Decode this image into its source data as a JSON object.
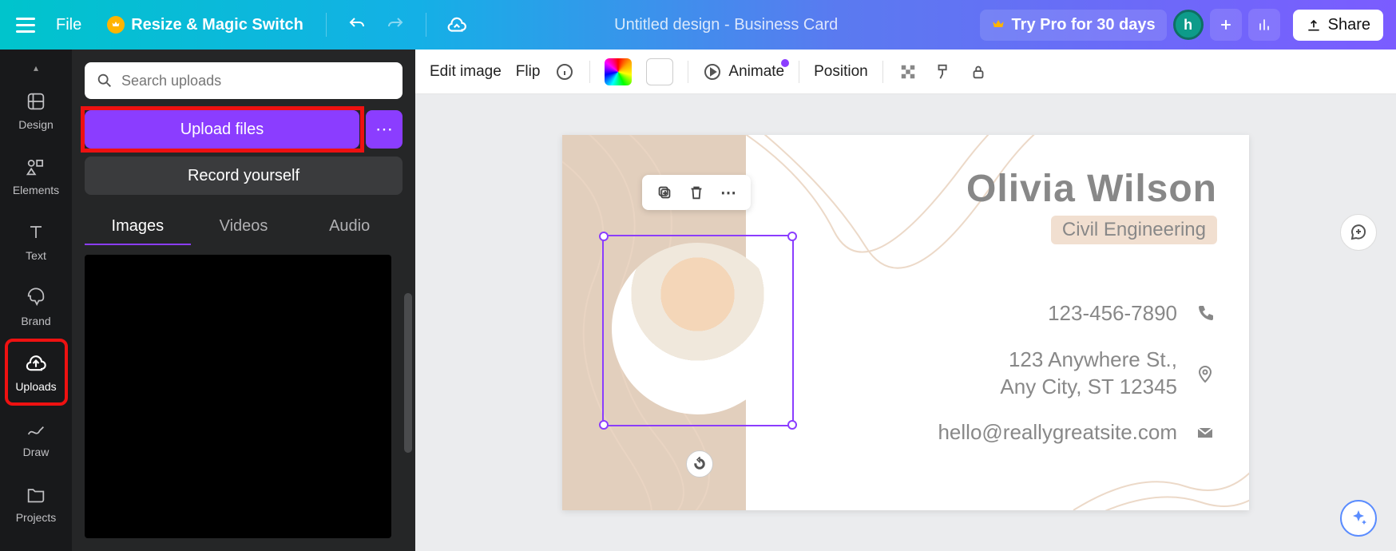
{
  "header": {
    "file": "File",
    "resize": "Resize & Magic Switch",
    "doc_title": "Untitled design - Business Card",
    "try_pro": "Try Pro for 30 days",
    "avatar_initial": "h",
    "share": "Share"
  },
  "rail": {
    "items": [
      {
        "label": "Design",
        "name": "nav-design"
      },
      {
        "label": "Elements",
        "name": "nav-elements"
      },
      {
        "label": "Text",
        "name": "nav-text"
      },
      {
        "label": "Brand",
        "name": "nav-brand"
      },
      {
        "label": "Uploads",
        "name": "nav-uploads"
      },
      {
        "label": "Draw",
        "name": "nav-draw"
      },
      {
        "label": "Projects",
        "name": "nav-projects"
      }
    ]
  },
  "panel": {
    "search_placeholder": "Search uploads",
    "upload": "Upload files",
    "record": "Record yourself",
    "tabs": [
      "Images",
      "Videos",
      "Audio"
    ]
  },
  "toolbar": {
    "edit_image": "Edit image",
    "flip": "Flip",
    "animate": "Animate",
    "position": "Position"
  },
  "card": {
    "name": "Olivia Wilson",
    "role": "Civil Engineering",
    "phone": "123-456-7890",
    "addr1": "123 Anywhere St.,",
    "addr2": "Any City, ST 12345",
    "email": "hello@reallygreatsite.com"
  }
}
